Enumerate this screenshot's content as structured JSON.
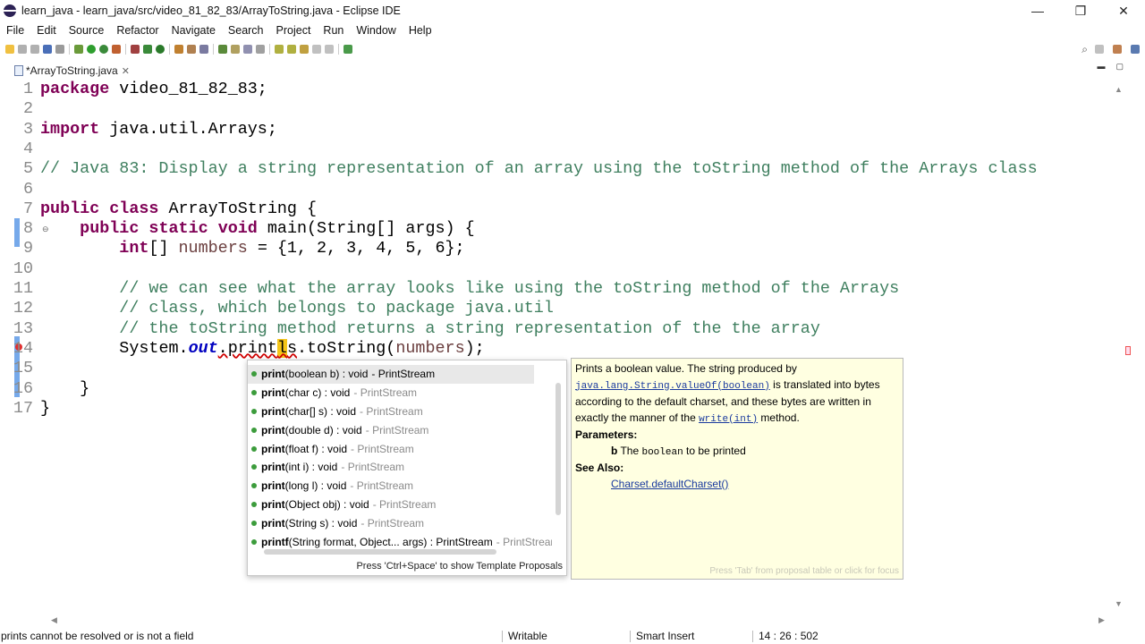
{
  "window": {
    "title": "learn_java - learn_java/src/video_81_82_83/ArrayToString.java - Eclipse IDE",
    "minimize": "—",
    "maximize": "❐",
    "close": "✕"
  },
  "menu": [
    "File",
    "Edit",
    "Source",
    "Refactor",
    "Navigate",
    "Search",
    "Project",
    "Run",
    "Window",
    "Help"
  ],
  "editor_tab": {
    "label": "*ArrayToString.java",
    "close": "✕"
  },
  "code": {
    "line_numbers": [
      "1",
      "2",
      "3",
      "4",
      "5",
      "6",
      "7",
      "8",
      "9",
      "10",
      "11",
      "12",
      "13",
      "14",
      "15",
      "16",
      "17"
    ],
    "l1_kw": "package",
    "l1_rest": " video_81_82_83;",
    "l3_kw": "import",
    "l3_rest": " java.util.Arrays;",
    "l5_comment": "// Java 83: Display a string representation of an array using the toString method of the Arrays class",
    "l7_kw1": "public",
    "l7_kw2": "class",
    "l7_rest": " ArrayToString {",
    "l8_indent": "    ",
    "l8_kw1": "public",
    "l8_kw2": "static",
    "l8_kw3": "void",
    "l8_rest": " main(String[] args) {",
    "l9_indent": "        ",
    "l9_kw": "int",
    "l9_a": "[] ",
    "l9_var": "numbers",
    "l9_b": " = {1, 2, 3, 4, 5, 6};",
    "l11": "        // we can see what the array looks like using the toString method of the Arrays",
    "l12": "        // class, which belongs to package java.util",
    "l13": "        // the toString method returns a string representation of the the array",
    "l14_indent": "        ",
    "l14_a": "System.",
    "l14_field": "out",
    "l14_b": ".print",
    "l14_hl": "l",
    "l14_c": "s",
    "l14_d": ".toString(",
    "l14_var": "numbers",
    "l14_e": ");",
    "l16": "    }",
    "l17": "}"
  },
  "content_assist": {
    "items": [
      {
        "name": "print",
        "sig": "(boolean b) : void",
        "type": "- PrintStream"
      },
      {
        "name": "print",
        "sig": "(char c) : void",
        "type": "- PrintStream"
      },
      {
        "name": "print",
        "sig": "(char[] s) : void",
        "type": "- PrintStream"
      },
      {
        "name": "print",
        "sig": "(double d) : void",
        "type": "- PrintStream"
      },
      {
        "name": "print",
        "sig": "(float f) : void",
        "type": "- PrintStream"
      },
      {
        "name": "print",
        "sig": "(int i) : void",
        "type": "- PrintStream"
      },
      {
        "name": "print",
        "sig": "(long l) : void",
        "type": "- PrintStream"
      },
      {
        "name": "print",
        "sig": "(Object obj) : void",
        "type": "- PrintStream"
      },
      {
        "name": "print",
        "sig": "(String s) : void",
        "type": "- PrintStream"
      },
      {
        "name": "printf",
        "sig": "(String format, Object... args) : PrintStream",
        "type": "- PrintStream"
      }
    ],
    "footer": "Press 'Ctrl+Space' to show Template Proposals"
  },
  "javadoc": {
    "p1": "Prints a boolean value. The string produced by",
    "p1_code": "java.lang.String.valueOf(boolean)",
    "p1_b": " is translated into bytes according to the default charset, and these bytes are written in exactly the manner of the ",
    "p1_code2": "write(int)",
    "p1_c": " method.",
    "params_label": "Parameters:",
    "param_name": "b",
    "param_desc_a": " The ",
    "param_code": "boolean",
    "param_desc_b": " to be printed",
    "see_label": "See Also:",
    "see_link": "Charset.defaultCharset()",
    "footer": "Press 'Tab' from proposal table or click for focus"
  },
  "status": {
    "message": "prints cannot be resolved or is not a field",
    "writable": "Writable",
    "insert_mode": "Smart Insert",
    "position": "14 : 26 : 502"
  }
}
